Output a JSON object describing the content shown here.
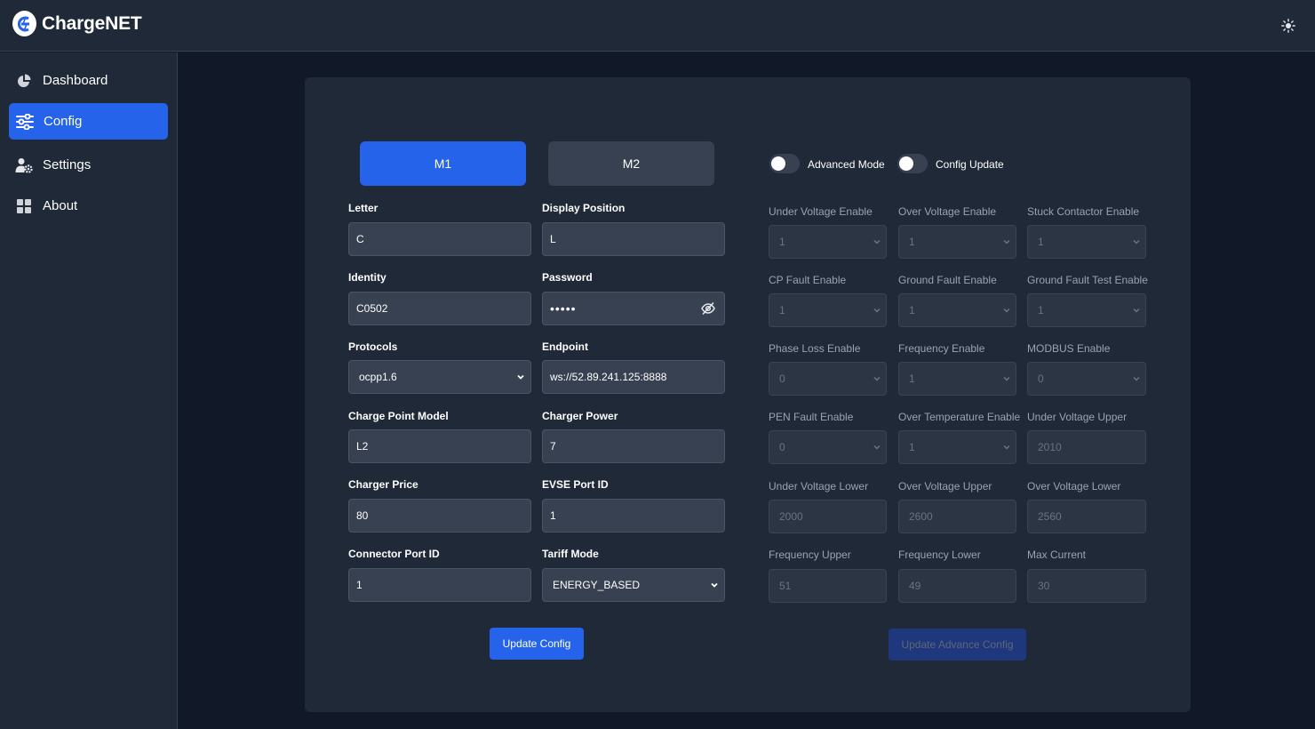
{
  "header": {
    "brand": "ChargeNET",
    "theme_icon": "sun-icon"
  },
  "sidebar": {
    "items": [
      {
        "label": "Dashboard",
        "icon": "pie-chart-icon",
        "active": false
      },
      {
        "label": "Config",
        "icon": "sliders-icon",
        "active": true
      },
      {
        "label": "Settings",
        "icon": "user-gear-icon",
        "active": false
      },
      {
        "label": "About",
        "icon": "grid-icon",
        "active": false
      }
    ]
  },
  "config": {
    "tabs": [
      {
        "label": "M1",
        "active": true
      },
      {
        "label": "M2",
        "active": false
      }
    ],
    "fields": {
      "letter": {
        "label": "Letter",
        "value": "C"
      },
      "display_position": {
        "label": "Display Position",
        "value": "L"
      },
      "identity": {
        "label": "Identity",
        "value": "C0502"
      },
      "password": {
        "label": "Password",
        "value": "•••••"
      },
      "protocols": {
        "label": "Protocols",
        "value": "ocpp1.6"
      },
      "endpoint": {
        "label": "Endpoint",
        "value": "ws://52.89.241.125:8888"
      },
      "charge_point_model": {
        "label": "Charge Point Model",
        "value": "L2"
      },
      "charger_power": {
        "label": "Charger Power",
        "value": "7"
      },
      "charger_price": {
        "label": "Charger Price",
        "value": "80"
      },
      "evse_port_id": {
        "label": "EVSE Port ID",
        "value": "1"
      },
      "connector_port_id": {
        "label": "Connector Port ID",
        "value": "1"
      },
      "tariff_mode": {
        "label": "Tariff Mode",
        "value": "ENERGY_BASED"
      }
    },
    "update_button": "Update Config"
  },
  "advanced": {
    "toggles": [
      {
        "label": "Advanced Mode",
        "on": false
      },
      {
        "label": "Config Update",
        "on": false
      }
    ],
    "fields": [
      {
        "label": "Under Voltage Enable",
        "value": "1",
        "type": "select"
      },
      {
        "label": "Over Voltage Enable",
        "value": "1",
        "type": "select"
      },
      {
        "label": "Stuck Contactor Enable",
        "value": "1",
        "type": "select"
      },
      {
        "label": "CP Fault Enable",
        "value": "1",
        "type": "select"
      },
      {
        "label": "Ground Fault Enable",
        "value": "1",
        "type": "select"
      },
      {
        "label": "Ground Fault Test Enable",
        "value": "1",
        "type": "select"
      },
      {
        "label": "Phase Loss Enable",
        "value": "0",
        "type": "select"
      },
      {
        "label": "Frequency Enable",
        "value": "1",
        "type": "select"
      },
      {
        "label": "MODBUS Enable",
        "value": "0",
        "type": "select"
      },
      {
        "label": "PEN Fault Enable",
        "value": "0",
        "type": "select"
      },
      {
        "label": "Over Temperature Enable",
        "value": "1",
        "type": "select"
      },
      {
        "label": "Under Voltage Upper",
        "value": "2010",
        "type": "input"
      },
      {
        "label": "Under Voltage Lower",
        "value": "2000",
        "type": "input"
      },
      {
        "label": "Over Voltage Upper",
        "value": "2600",
        "type": "input"
      },
      {
        "label": "Over Voltage Lower",
        "value": "2560",
        "type": "input"
      },
      {
        "label": "Frequency Upper",
        "value": "51",
        "type": "input"
      },
      {
        "label": "Frequency Lower",
        "value": "49",
        "type": "input"
      },
      {
        "label": "Max Current",
        "value": "30",
        "type": "input"
      }
    ],
    "update_button": "Update Advance Config"
  },
  "colors": {
    "accent": "#2563eb",
    "background": "#111827",
    "surface": "#1f2937",
    "input": "#374151"
  }
}
